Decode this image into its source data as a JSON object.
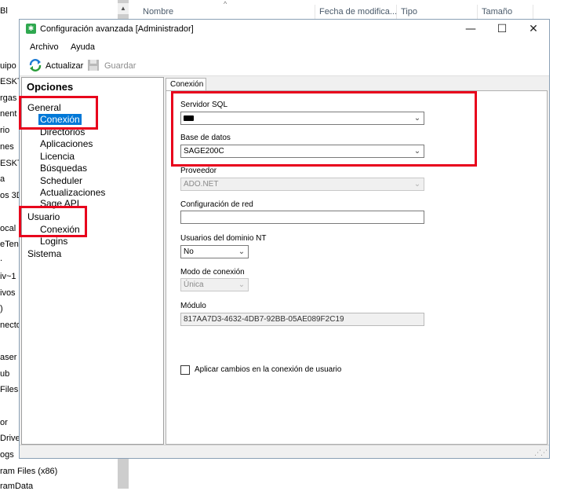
{
  "background": {
    "left_fragments": [
      "Bl",
      "uipo",
      "ESKT",
      "rgas",
      "nent",
      "rio",
      "nes",
      "ESKT",
      "a",
      "os 3D",
      "ocal",
      "eTen",
      ".",
      "iv~1",
      "ivos",
      ")",
      "necto",
      "aser",
      "ub",
      "Files",
      "or",
      "Drive",
      "ogs"
    ],
    "bottom_fragments": [
      "ram Files (x86)",
      "ramData"
    ],
    "columns": {
      "name": "Nombre",
      "modified": "Fecha de modifica...",
      "type": "Tipo",
      "size": "Tamaño"
    }
  },
  "dialog": {
    "title": "Configuración avanzada [Administrador]",
    "menu": {
      "file": "Archivo",
      "help": "Ayuda"
    },
    "toolbar": {
      "refresh": "Actualizar",
      "save": "Guardar"
    },
    "window_controls": {
      "minimize": "—",
      "maximize": "☐",
      "close": "✕"
    }
  },
  "tree": {
    "heading": "Opciones",
    "general": {
      "label": "General",
      "children": [
        "Conexión",
        "Directorios",
        "Aplicaciones",
        "Licencia",
        "Búsquedas",
        "Scheduler",
        "Actualizaciones",
        "Sage API"
      ]
    },
    "user": {
      "label": "Usuario",
      "children": [
        "Conexión",
        "Logins"
      ]
    },
    "system": {
      "label": "Sistema"
    },
    "selected": "General > Conexión"
  },
  "tab": {
    "label": "Conexión"
  },
  "form": {
    "sql_server": {
      "label": "Servidor SQL",
      "value": ""
    },
    "database": {
      "label": "Base de datos",
      "value": "SAGE200C"
    },
    "provider": {
      "label": "Proveedor",
      "value": "ADO.NET"
    },
    "network_config": {
      "label": "Configuración de red",
      "value": ""
    },
    "nt_domain_users": {
      "label": "Usuarios del dominio NT",
      "value": "No"
    },
    "connection_mode": {
      "label": "Modo de conexión",
      "value": "Única"
    },
    "module": {
      "label": "Módulo",
      "value": "817AA7D3-4632-4DB7-92BB-05AE089F2C19"
    },
    "apply_user_connection": {
      "label": "Aplicar cambios en la conexión de usuario",
      "checked": false
    }
  },
  "colors": {
    "highlight": "#e8001c",
    "selection": "#0078d7",
    "dialog_bg": "#f0f0f0"
  },
  "icons": {
    "app": "app-icon",
    "refresh": "refresh-icon",
    "save": "save-disk-icon",
    "dropdown": "chevron-down-icon"
  }
}
